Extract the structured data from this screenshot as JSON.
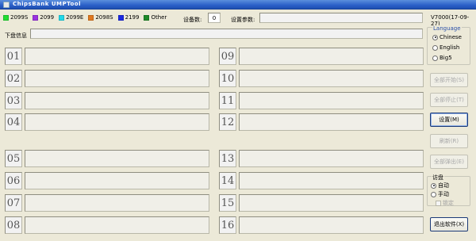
{
  "window": {
    "title": "ChipsBank UMPTool"
  },
  "legend": [
    {
      "label": "2099S",
      "color": "#22dd33"
    },
    {
      "label": "2099",
      "color": "#9a33e0"
    },
    {
      "label": "2099E",
      "color": "#22d8e8"
    },
    {
      "label": "2098S",
      "color": "#e07a22"
    },
    {
      "label": "2199",
      "color": "#1c2ae0"
    },
    {
      "label": "Other",
      "color": "#1f8a2a"
    }
  ],
  "device_count": {
    "label": "设备数:",
    "value": "0"
  },
  "settings_param": {
    "label": "设置参数:",
    "value": ""
  },
  "download_info": {
    "label": "下盘信息",
    "value": ""
  },
  "ports": [
    "01",
    "02",
    "03",
    "04",
    "05",
    "06",
    "07",
    "08",
    "09",
    "10",
    "11",
    "12",
    "13",
    "14",
    "15",
    "16"
  ],
  "version": "V7000(17-09-27)",
  "language": {
    "title": "Language",
    "options": [
      "Chinese",
      "English",
      "Big5"
    ],
    "selected": "Chinese"
  },
  "buttons": {
    "start_all": "全部开始(S)",
    "stop_all": "全部停止(T)",
    "settings": "设置(M)",
    "refresh": "刷新(R)",
    "pop_all": "全部弹出(E)",
    "exit": "退出软件(X)"
  },
  "mode": {
    "title": "访盘",
    "options": [
      "自动",
      "手动"
    ],
    "selected": "自动",
    "lock_label": "锁定"
  }
}
